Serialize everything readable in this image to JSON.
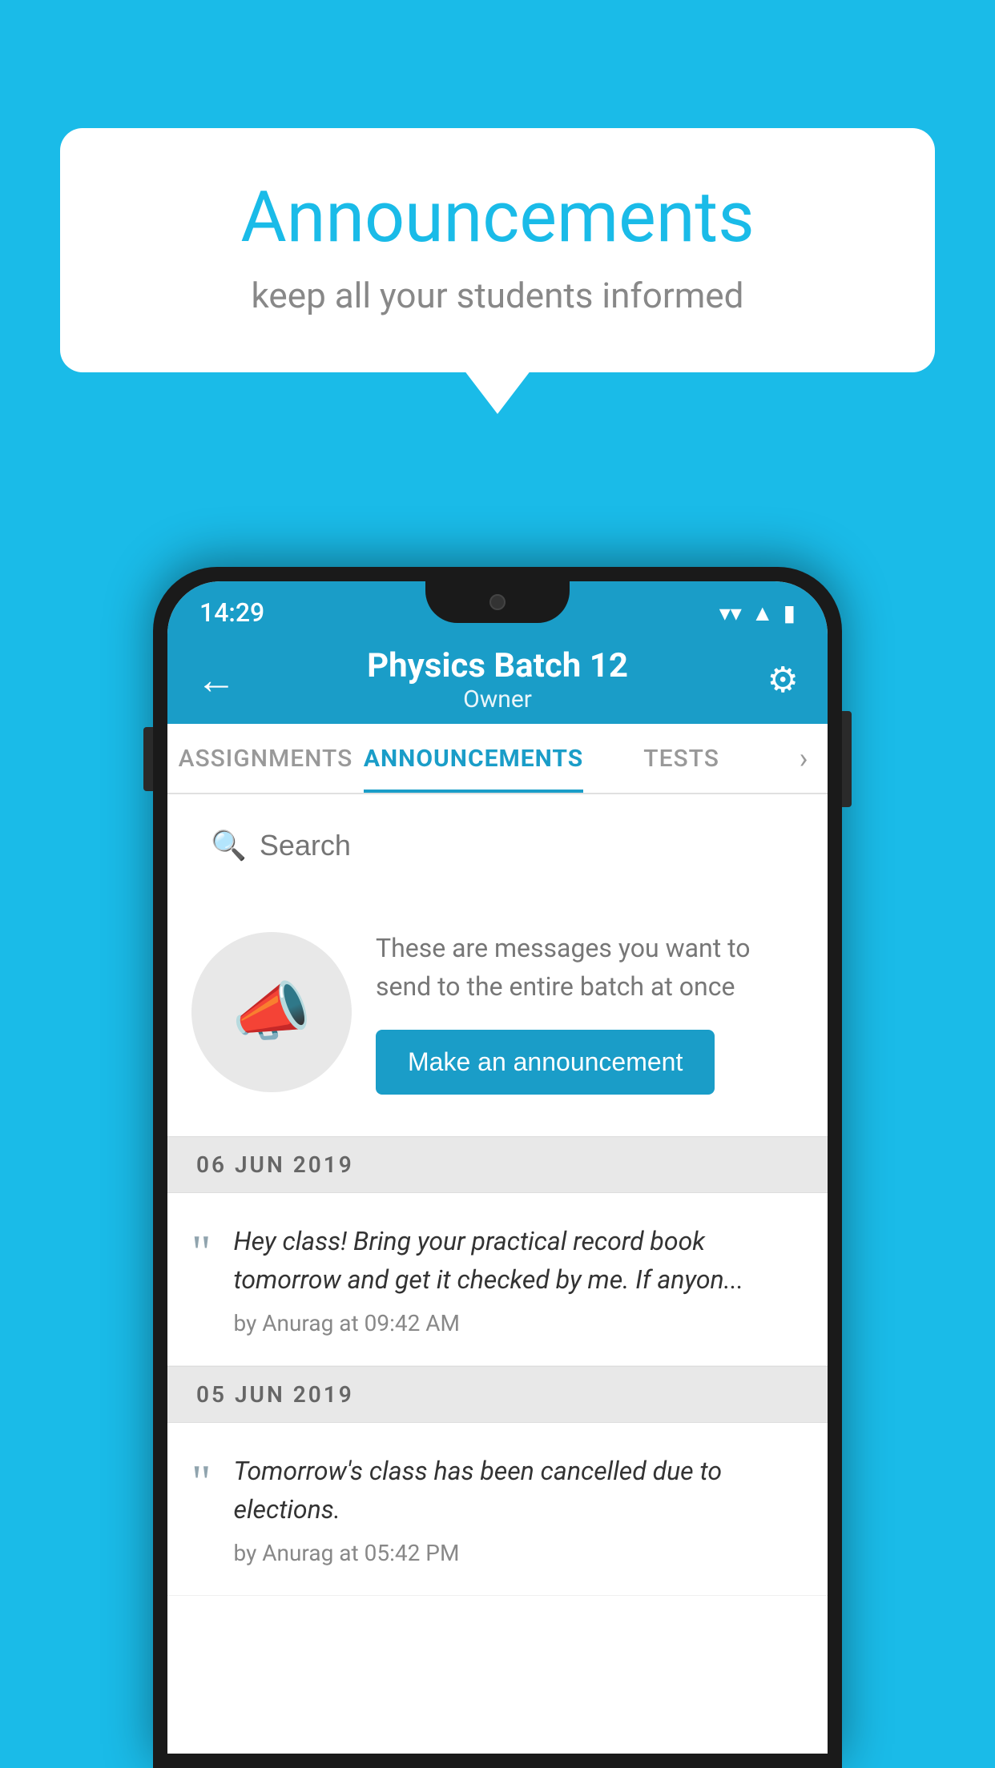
{
  "background_color": "#1ABBE8",
  "speech_bubble": {
    "title": "Announcements",
    "subtitle": "keep all your students informed"
  },
  "phone": {
    "status_bar": {
      "time": "14:29",
      "wifi": "▼",
      "signal": "◀",
      "battery": "▮"
    },
    "app_bar": {
      "back_icon": "←",
      "title": "Physics Batch 12",
      "subtitle": "Owner",
      "settings_icon": "⚙"
    },
    "tabs": [
      {
        "label": "ASSIGNMENTS",
        "active": false
      },
      {
        "label": "ANNOUNCEMENTS",
        "active": true
      },
      {
        "label": "TESTS",
        "active": false
      }
    ],
    "search": {
      "placeholder": "Search"
    },
    "promo": {
      "description": "These are messages you want to send to the entire batch at once",
      "button_label": "Make an announcement"
    },
    "announcements": [
      {
        "date": "06  JUN  2019",
        "text": "Hey class! Bring your practical record book tomorrow and get it checked by me. If anyon...",
        "meta": "by Anurag at 09:42 AM"
      },
      {
        "date": "05  JUN  2019",
        "text": "Tomorrow's class has been cancelled due to elections.",
        "meta": "by Anurag at 05:42 PM"
      }
    ]
  }
}
